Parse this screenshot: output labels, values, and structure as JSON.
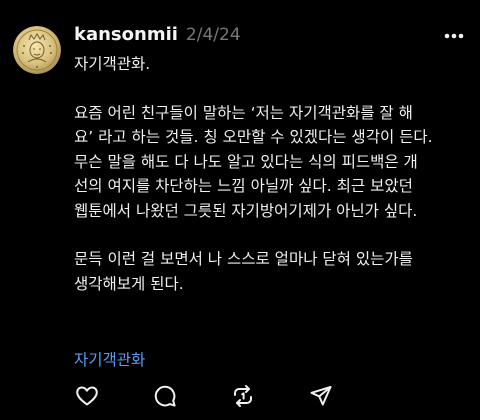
{
  "post": {
    "username": "kansonmii",
    "date": "2/4/24",
    "title_line": "자기객관화.",
    "paragraph1_lines": [
      "요즘 어린 친구들이 말하는 ‘저는 자기객관화를 잘 해",
      "요’ 라고 하는 것들. 칭 오만할 수 있겠다는 생각이 든다.",
      "무슨 말을 해도 다 나도 알고 있다는 식의 피드백은 개",
      "선의 여지를 차단하는 느낌 아닐까 싶다. 최근 보았던",
      "웹툰에서 나왔던 그릇된 자기방어기제가 아닌가 싶다."
    ],
    "paragraph2_lines": [
      "문득 이런 걸 보면서 나 스스로 얼마나 닫혀 있는가를",
      "생각해보게 된다."
    ],
    "tag": "자기객관화"
  },
  "icons": {
    "more": "more-horizontal-icon",
    "like": "heart-icon",
    "reply": "comment-bubble-icon",
    "repost": "repost-icon",
    "share": "send-icon"
  },
  "colors": {
    "background": "#000000",
    "text": "#f0f0f0",
    "muted": "#777777",
    "tag": "#5b9df5"
  }
}
